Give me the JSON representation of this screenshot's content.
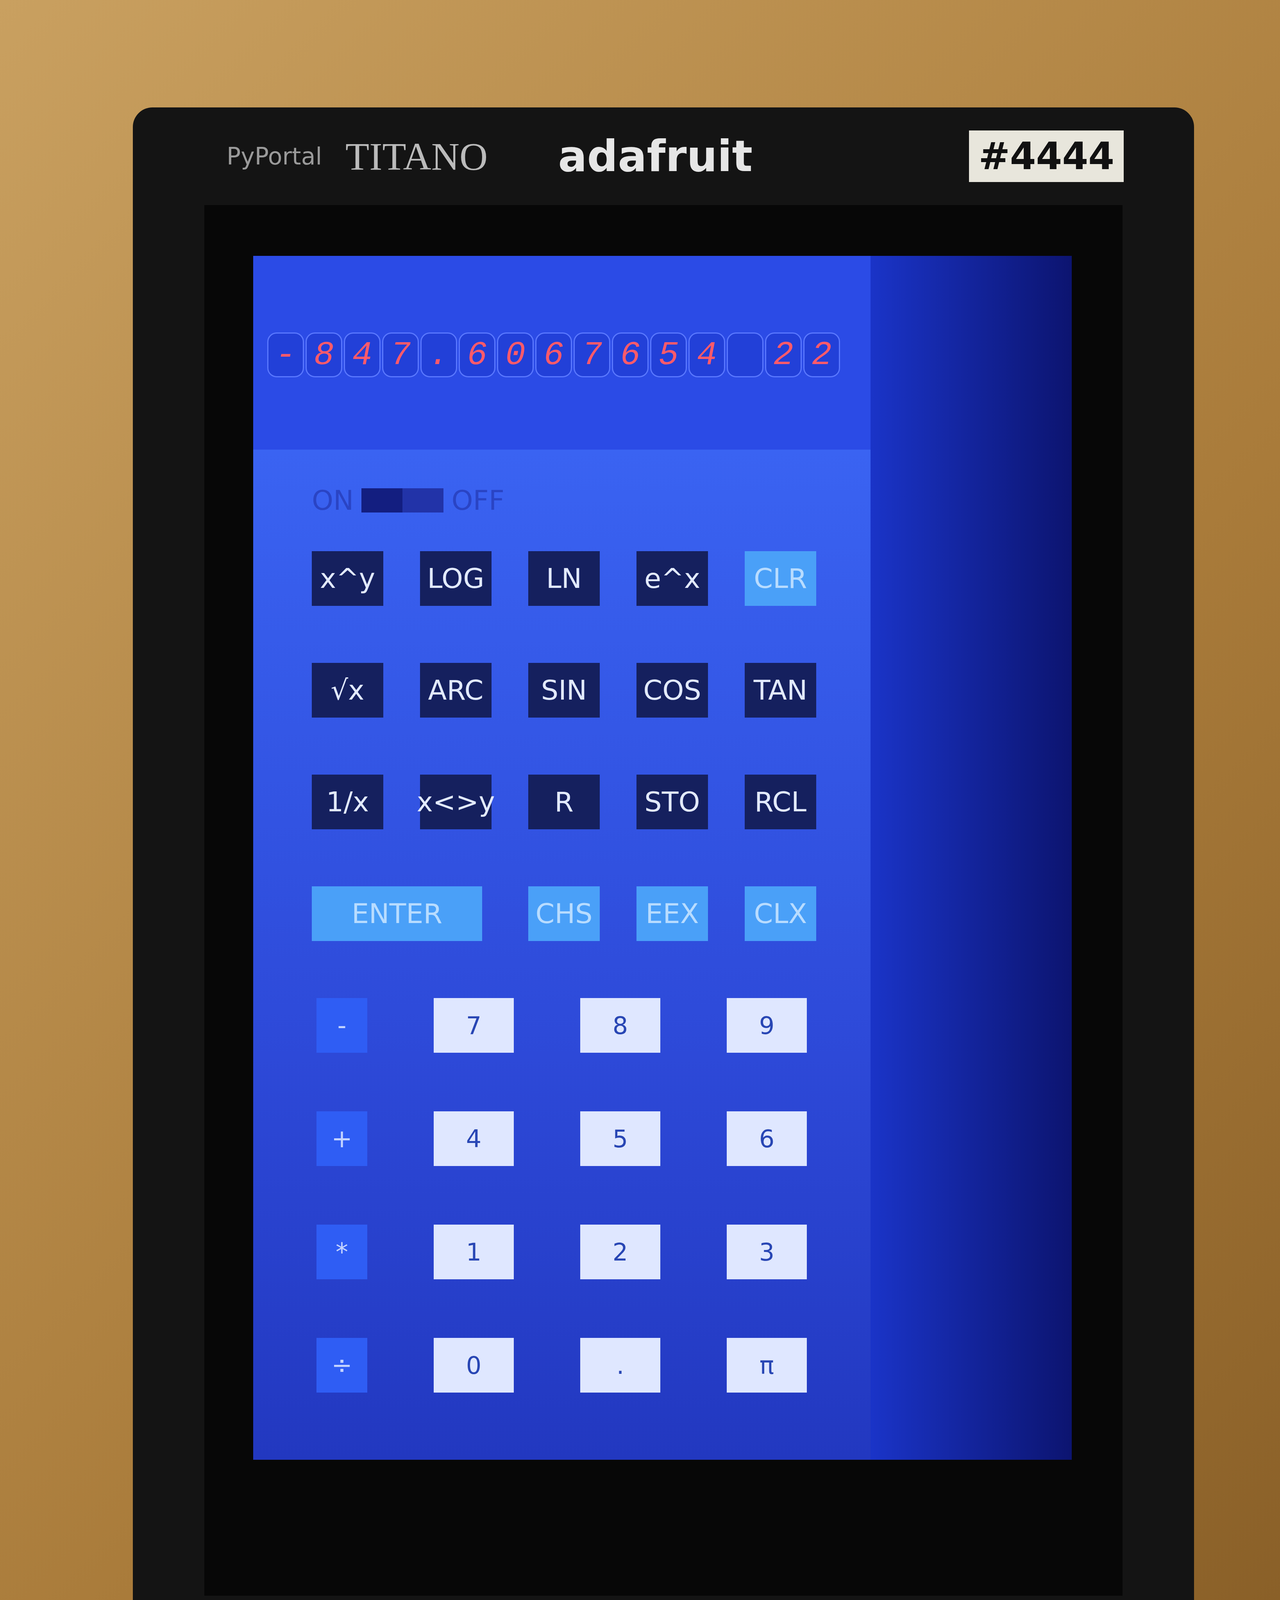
{
  "board": {
    "labels": [
      "PyPortal",
      "TITANO",
      "adafruit",
      "#4444"
    ]
  },
  "display": {
    "cells": [
      "-",
      "8",
      "4",
      "7",
      ".",
      "6",
      "0",
      "6",
      "7",
      "6",
      "5",
      "4",
      " ",
      "2",
      "2"
    ]
  },
  "power": {
    "on_label": "ON",
    "off_label": "OFF",
    "on": true
  },
  "function_rows": [
    [
      {
        "label": "x^y",
        "kind": "function"
      },
      {
        "label": "LOG",
        "kind": "function"
      },
      {
        "label": "LN",
        "kind": "function"
      },
      {
        "label": "e^x",
        "kind": "function"
      },
      {
        "label": "CLR",
        "kind": "accent"
      }
    ],
    [
      {
        "label": "√x",
        "kind": "function"
      },
      {
        "label": "ARC",
        "kind": "function"
      },
      {
        "label": "SIN",
        "kind": "function"
      },
      {
        "label": "COS",
        "kind": "function"
      },
      {
        "label": "TAN",
        "kind": "function"
      }
    ],
    [
      {
        "label": "1/x",
        "kind": "function"
      },
      {
        "label": "x<>y",
        "kind": "function"
      },
      {
        "label": "R",
        "kind": "function"
      },
      {
        "label": "STO",
        "kind": "function"
      },
      {
        "label": "RCL",
        "kind": "function"
      }
    ]
  ],
  "enter_row": [
    {
      "label": "ENTER",
      "kind": "wide"
    },
    {
      "label": "CHS",
      "kind": "accent"
    },
    {
      "label": "EEX",
      "kind": "accent"
    },
    {
      "label": "CLX",
      "kind": "accent"
    }
  ],
  "number_rows": [
    [
      {
        "label": "-",
        "kind": "operator"
      },
      {
        "label": "7",
        "kind": "digit"
      },
      {
        "label": "8",
        "kind": "digit"
      },
      {
        "label": "9",
        "kind": "digit"
      }
    ],
    [
      {
        "label": "+",
        "kind": "operator"
      },
      {
        "label": "4",
        "kind": "digit"
      },
      {
        "label": "5",
        "kind": "digit"
      },
      {
        "label": "6",
        "kind": "digit"
      }
    ],
    [
      {
        "label": "*",
        "kind": "operator"
      },
      {
        "label": "1",
        "kind": "digit"
      },
      {
        "label": "2",
        "kind": "digit"
      },
      {
        "label": "3",
        "kind": "digit"
      }
    ],
    [
      {
        "label": "÷",
        "kind": "operator"
      },
      {
        "label": "0",
        "kind": "digit"
      },
      {
        "label": ".",
        "kind": "digit"
      },
      {
        "label": "π",
        "kind": "digit"
      }
    ]
  ]
}
